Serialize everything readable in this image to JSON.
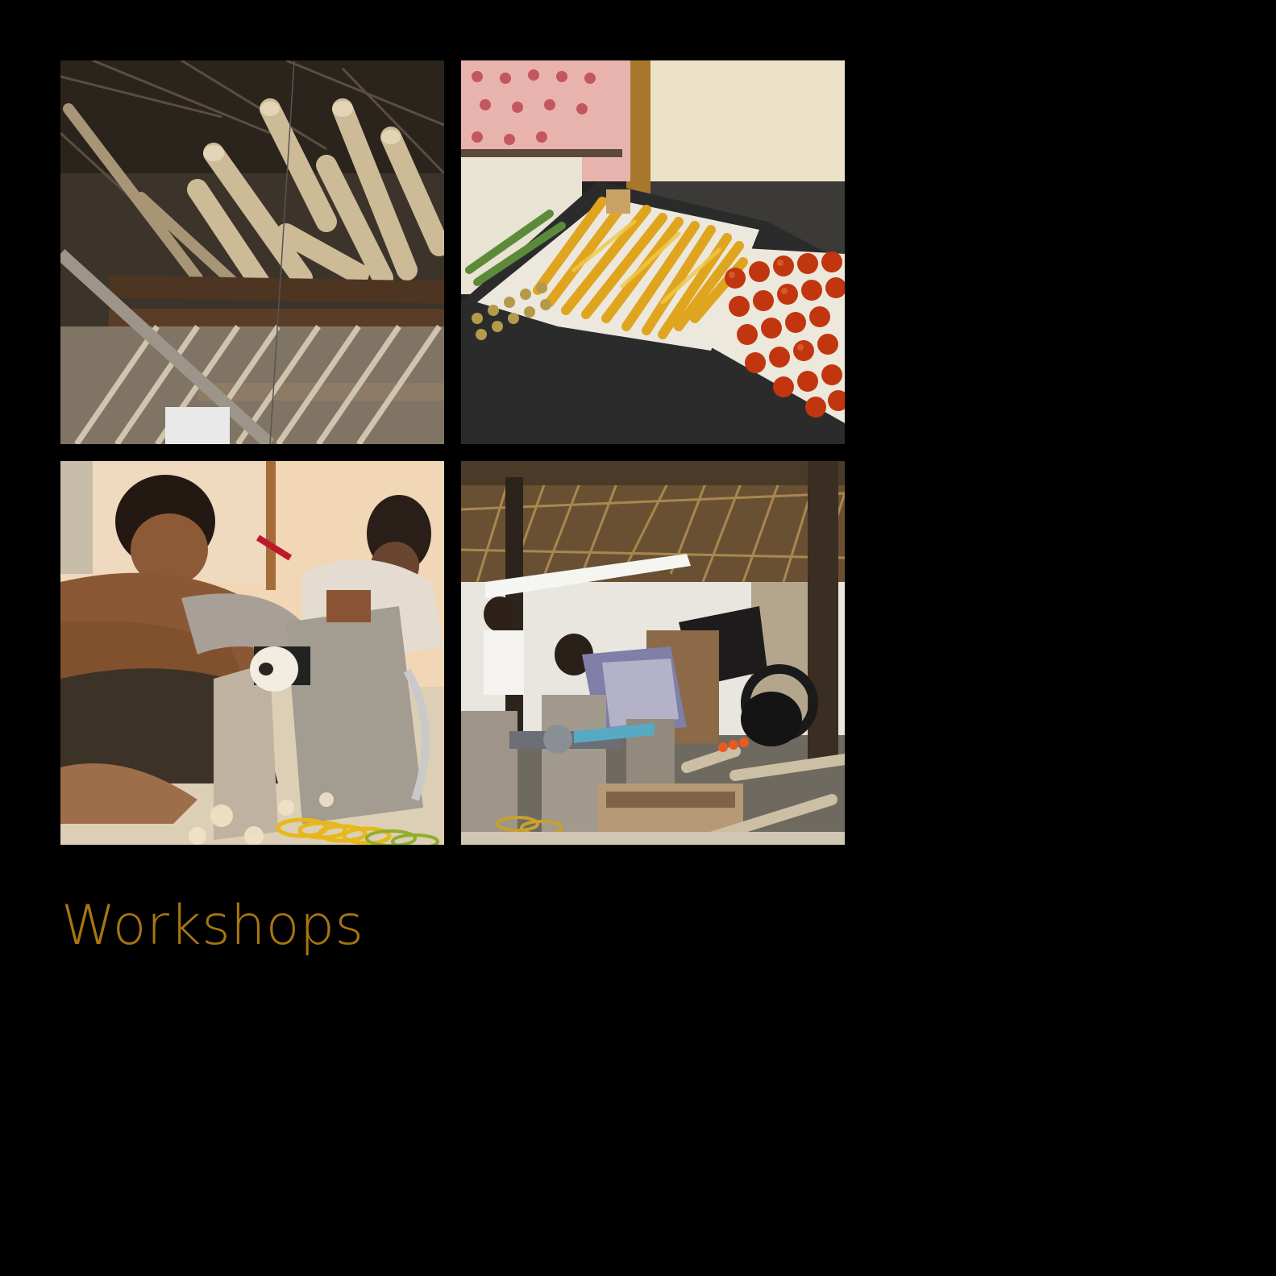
{
  "page": {
    "title": "Workshops",
    "title_color": "#a8760f",
    "background": "#000000"
  },
  "photos": [
    {
      "name": "photo-timber-roof"
    },
    {
      "name": "photo-lacquered-pieces"
    },
    {
      "name": "photo-lathe-turner"
    },
    {
      "name": "photo-workshop-shed"
    }
  ]
}
